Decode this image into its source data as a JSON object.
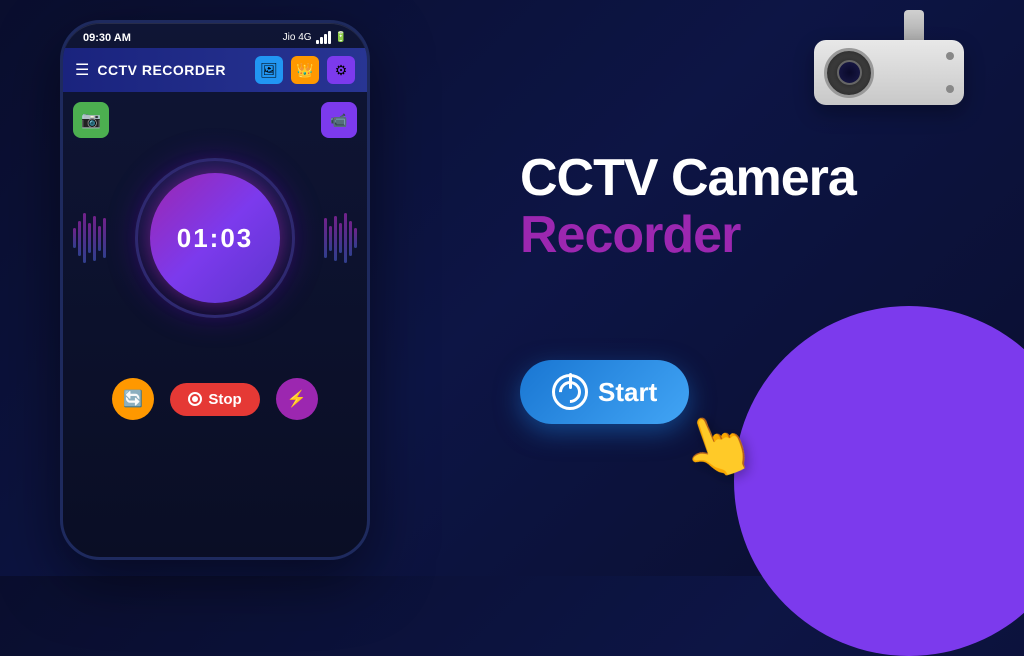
{
  "app": {
    "title": "CCTV RECORDER",
    "status_bar": {
      "time": "09:30 AM",
      "carrier": "Jio 4G"
    }
  },
  "header": {
    "title": "CCTV RECORDER",
    "icons": {
      "gallery_label": "🖼",
      "crown_label": "👑",
      "settings_label": "⚙"
    }
  },
  "timer": {
    "display": "01:03"
  },
  "controls": {
    "stop_label": "Stop",
    "refresh_icon": "🔄",
    "lightning_icon": "⚡"
  },
  "hero": {
    "headline_line1": "CCTV Camera",
    "headline_line2": "Recorder",
    "start_button": "Start"
  },
  "buttons": {
    "camera_icon": "📷",
    "screen_record_icon": "📹"
  }
}
